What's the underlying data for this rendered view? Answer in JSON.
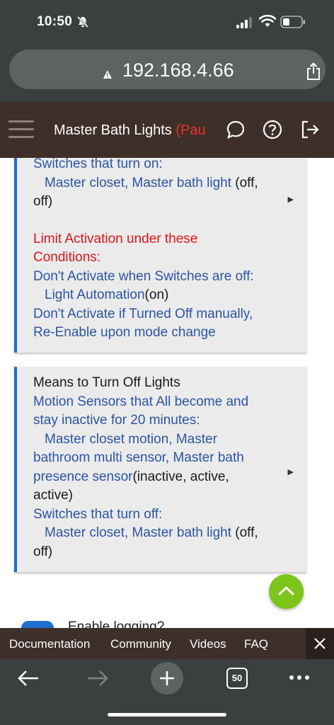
{
  "status_bar": {
    "time": "10:50"
  },
  "browser": {
    "url": "192.168.4.66",
    "tab_count": "50"
  },
  "app_header": {
    "title": "Master Bath Lights ",
    "title_suffix": "(Pau"
  },
  "card1": {
    "switches_on_label": "Switches that turn on:",
    "switches_on_devices": "Master closet, Master bath light",
    "switches_on_state_1": " (off,",
    "switches_on_state_2": "off)",
    "limit_heading_1": "Limit Activation under these",
    "limit_heading_2": "Conditions:",
    "dont_activate_switches": "Don't Activate when Switches are off:",
    "light_automation": "Light Automation",
    "light_automation_state": "(on)",
    "dont_activate_manual_1": "Don't Activate if Turned Off manually,",
    "dont_activate_manual_2": "Re-Enable upon mode change",
    "expand_arrow": "▶"
  },
  "card2": {
    "heading": "Means to Turn Off Lights",
    "motion_label_1": "Motion Sensors that All become and",
    "motion_label_2": "stay inactive for 20 minutes:",
    "motion_devices_1": "Master closet motion, Master",
    "motion_devices_2": "bathroom multi sensor, Master bath",
    "motion_devices_3": "presence sensor",
    "motion_state_1": "(inactive, active,",
    "motion_state_2": "active)",
    "switches_off_label": "Switches that turn off:",
    "switches_off_devices": "Master closet, Master bath light",
    "switches_off_state_1": " (off,",
    "switches_off_state_2": "off)",
    "expand_arrow": "▶"
  },
  "partial_section": {
    "label": "Enable logging?"
  },
  "footer_links": {
    "documentation": "Documentation",
    "community": "Community",
    "videos": "Videos",
    "faq": "FAQ"
  },
  "colors": {
    "header_bg": "#3e2f29",
    "browser_bg": "#3a3f40",
    "accent_blue": "#1e6fd0",
    "link_blue": "#2a55a8",
    "alert_red": "#e0161a",
    "fab_green": "#7cc619"
  }
}
